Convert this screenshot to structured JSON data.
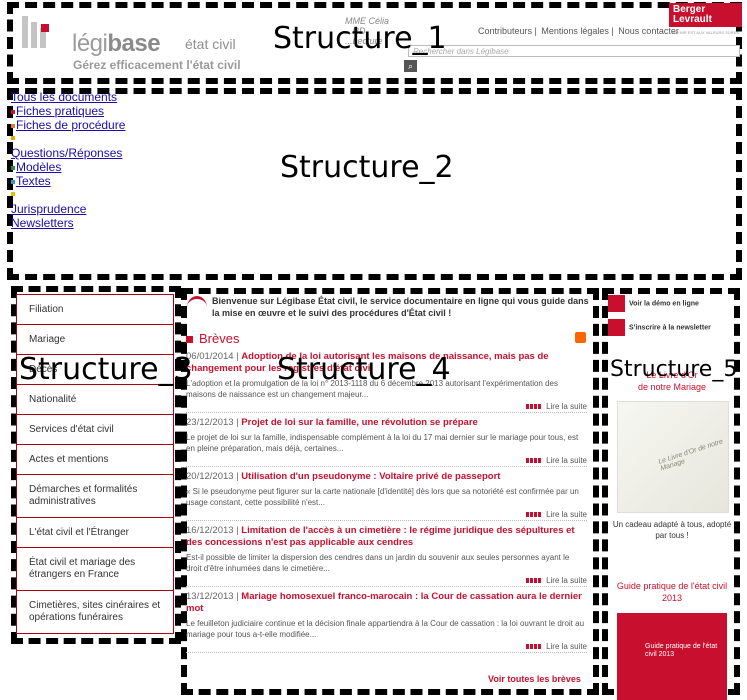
{
  "labels": {
    "s1": "Structure_1",
    "s2": "Structure_2",
    "s3": "Structure_3",
    "s4": "Structure_4",
    "s5": "Structure_5"
  },
  "header": {
    "brand_light": "légi",
    "brand_bold": "base",
    "brand_sub": "état civil",
    "tagline": "Gérez efficacement l'état civil",
    "user_lines": [
      "MME Célia",
      "...RD",
      "...Lecture"
    ],
    "links": [
      "Contributeurs |",
      "Mentions légales |",
      "Nous contacter"
    ],
    "publisher": "Berger Levrault",
    "publisher_tag": "L'AVENIR EST AUX VALEURS SÛRES",
    "search_placeholder": "Rechercher dans Légibase"
  },
  "nav": {
    "items": [
      "Tous les documents",
      "Fiches pratiques",
      "Fiches de procédure",
      "Questions/Réponses",
      "Modèles",
      "Textes",
      "Jurisprudence",
      "Newsletters"
    ]
  },
  "colors": {
    "accent": "#c8102e",
    "link": "#1a0dab"
  },
  "categories": [
    "Filiation",
    "Mariage",
    "Décès",
    "Nationalité",
    "Services d'état civil",
    "Actes et mentions",
    "Démarches et formalités administratives",
    "L'état civil et l'Étranger",
    "État civil et mariage des étrangers en France",
    "Cimetières, sites cinéraires et opérations funéraires"
  ],
  "main": {
    "welcome": "Bienvenue sur Légibase État civil, le service documentaire en ligne qui vous guide dans la mise en œuvre et le suivi des procédures d'État civil !",
    "breves_title": "Brèves",
    "read_more": "Lire la suite",
    "all_news": "Voir toutes les brèves",
    "items": [
      {
        "date": "06/01/2014 |",
        "title": "Adoption de la loi autorisant les maisons de naissance, mais pas de changement pour les registres d'état civil",
        "text": "L'adoption et la promulgation de la loi n° 2013-1118 du 6 décembre 2013 autorisant l'expérimentation des maisons de naissance est un changement majeur..."
      },
      {
        "date": "23/12/2013 |",
        "title": "Projet de loi sur la famille, une révolution se prépare",
        "text": "Le projet de loi sur la famille, indispensable complément à la loi du 17 mai dernier sur le mariage pour tous, est en pleine préparation, mais déjà, certaines..."
      },
      {
        "date": "20/12/2013 |",
        "title": "Utilisation d'un pseudonyme : Voltaire privé de passeport",
        "text": "« Si le pseudonyme peut figurer sur la carte nationale [d'identité] dès lors que sa notoriété est confirmée par un usage constant, cette possibilité n'est..."
      },
      {
        "date": "16/12/2013 |",
        "title": "Limitation de l'accès à un cimetière : le régime juridique des sépultures et des concessions n'est pas applicable aux cendres",
        "text": "Est-il possible de limiter la dispersion des cendres dans un jardin du souvenir aux seules personnes ayant le droit d'être inhumées dans le cimetière..."
      },
      {
        "date": "13/12/2013 |",
        "title": "Mariage homosexuel franco-marocain : la Cour de cassation aura le dernier mot",
        "text": "Le feuilleton judiciaire continue et la décision finale appartiendra à la Cour de cassation : la loi ouvrant le droit au mariage pour tous a-t-elle modifiée..."
      }
    ]
  },
  "right": {
    "demo": "Voir la démo en ligne",
    "newsletter": "S'inscrire à la newsletter",
    "promo1_title": [
      "Le Livre d'Or",
      "de notre Mariage"
    ],
    "promo1_cover": "Le Livre d'Or de notre Mariage",
    "promo1_caption": "Un cadeau adapté à tous, adopté par tous !",
    "promo2_title": "Guide pratique de l'état civil 2013",
    "promo2_cover": "Guide pratique de l'état civil 2013"
  }
}
